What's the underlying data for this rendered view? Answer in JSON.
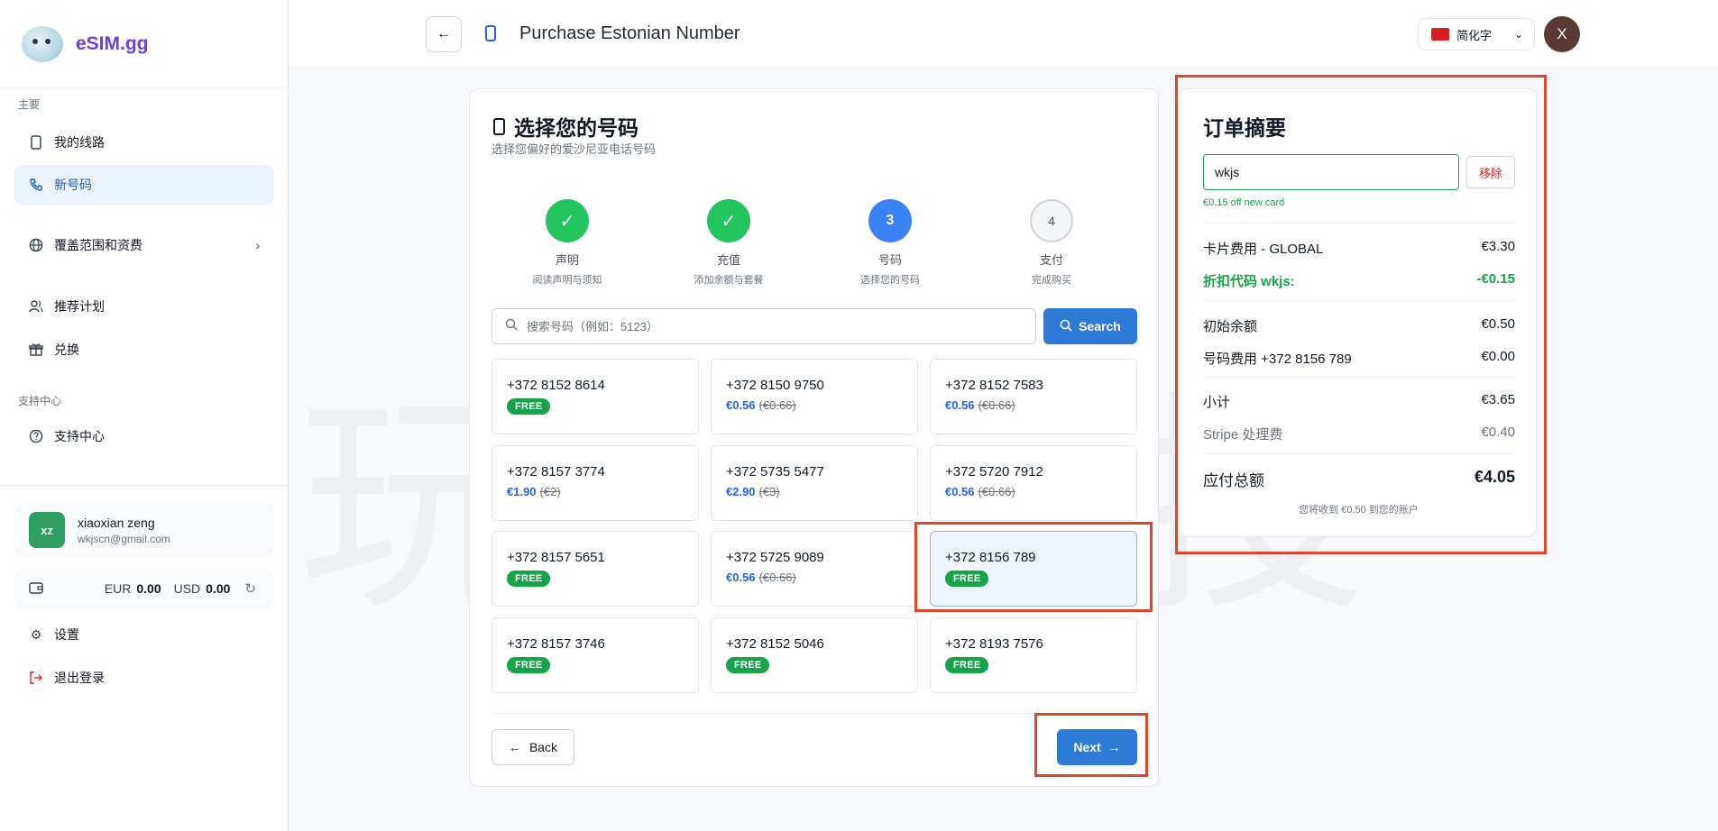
{
  "sidebar": {
    "brand": "eSIM.gg",
    "section_main": "主要",
    "items": [
      {
        "label": "我的线路",
        "icon": "phone-icon"
      },
      {
        "label": "新号码",
        "icon": "phone-call-icon",
        "active": true
      },
      {
        "label": "覆盖范围和资费",
        "icon": "globe-icon"
      },
      {
        "label": "推荐计划",
        "icon": "users-icon"
      },
      {
        "label": "兑换",
        "icon": "gift-icon"
      }
    ],
    "section_support": "支持中心",
    "support_item": {
      "label": "支持中心",
      "icon": "help-circle-icon"
    },
    "user": {
      "initials": "xz",
      "name": "xiaoxian zeng",
      "email": "wkjscn@gmail.com"
    },
    "balance": {
      "eur_label": "EUR",
      "eur_value": "0.00",
      "usd_label": "USD",
      "usd_value": "0.00"
    },
    "settings_label": "设置",
    "logout_label": "退出登录"
  },
  "header": {
    "title": "Purchase Estonian Number",
    "language": "简化字",
    "avatar_initial": "X"
  },
  "main": {
    "title": "选择您的号码",
    "subtitle": "选择您偏好的爱沙尼亚电话号码",
    "steps": [
      {
        "num": "✓",
        "name": "声明",
        "desc": "阅读声明与须知",
        "state": "done"
      },
      {
        "num": "✓",
        "name": "充值",
        "desc": "添加余额与套餐",
        "state": "done"
      },
      {
        "num": "3",
        "name": "号码",
        "desc": "选择您的号码",
        "state": "current"
      },
      {
        "num": "4",
        "name": "支付",
        "desc": "完成购买",
        "state": "todo"
      }
    ],
    "search_placeholder": "搜索号码（例如：5123）",
    "search_button": "Search",
    "numbers": [
      {
        "number": "+372 8152 8614",
        "badge": "FREE"
      },
      {
        "number": "+372 8150 9750",
        "price": "€0.56",
        "original": "(€0.66)"
      },
      {
        "number": "+372 8152 7583",
        "price": "€0.56",
        "original": "(€0.66)"
      },
      {
        "number": "+372 8157 3774",
        "price": "€1.90",
        "original": "(€2)"
      },
      {
        "number": "+372 5735 5477",
        "price": "€2.90",
        "original": "(€3)"
      },
      {
        "number": "+372 5720 7912",
        "price": "€0.56",
        "original": "(€0.66)"
      },
      {
        "number": "+372 8157 5651",
        "badge": "FREE"
      },
      {
        "number": "+372 5725 9089",
        "price": "€0.56",
        "original": "(€0.66)"
      },
      {
        "number": "+372 8156 789",
        "badge": "FREE",
        "selected": true
      },
      {
        "number": "+372 8157 3746",
        "badge": "FREE"
      },
      {
        "number": "+372 8152 5046",
        "badge": "FREE"
      },
      {
        "number": "+372 8193 7576",
        "badge": "FREE"
      }
    ],
    "back_button": "Back",
    "next_button": "Next"
  },
  "summary": {
    "title": "订单摘要",
    "coupon_value": "wkjs",
    "remove_button": "移除",
    "coupon_message": "€0.15 off new card",
    "rows": {
      "card_fee_label": "卡片费用 - GLOBAL",
      "card_fee_value": "€3.30",
      "discount_label": "折扣代码 wkjs:",
      "discount_value": "-€0.15",
      "initial_balance_label": "初始余额",
      "initial_balance_value": "€0.50",
      "number_fee_label": "号码费用 +372 8156 789",
      "number_fee_value": "€0.00",
      "subtotal_label": "小计",
      "subtotal_value": "€3.65",
      "stripe_fee_label": "Stripe 处理费",
      "stripe_fee_value": "€0.40",
      "total_label": "应付总额",
      "total_value": "€4.05"
    },
    "note": "您将收到 €0.50 到您的账户"
  },
  "watermark": "玩 数 授",
  "colors": {
    "accent": "#2d7bd6",
    "success": "#16a34a",
    "highlight": "#e0462c",
    "brand": "#6d3fd6"
  }
}
